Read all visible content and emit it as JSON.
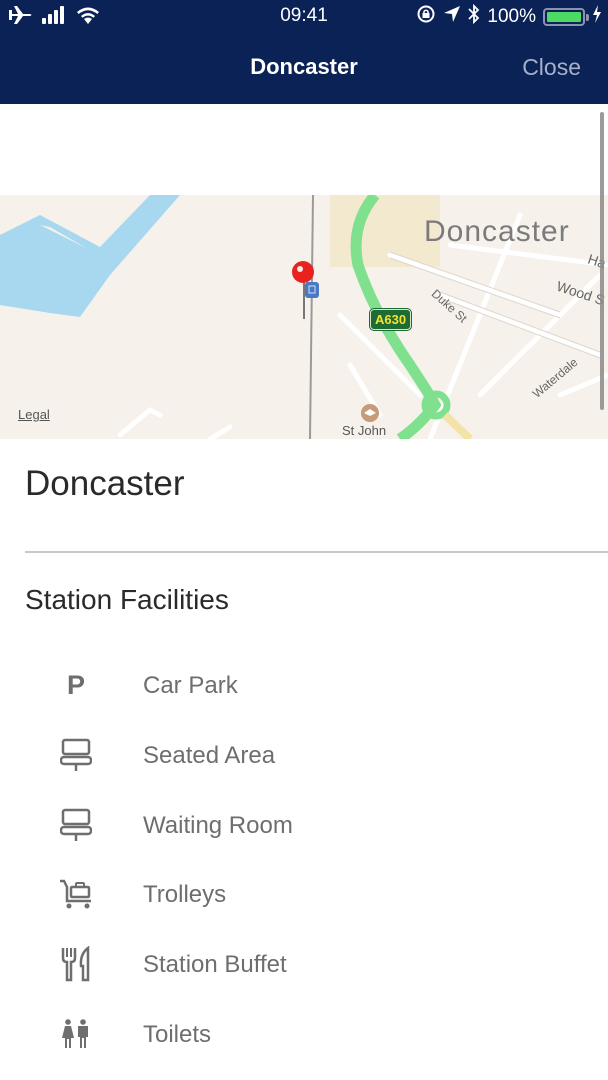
{
  "status_bar": {
    "time": "09:41",
    "battery_percent": "100%",
    "battery_level": 1.0,
    "icons_left": [
      "airplane-icon",
      "signal-icon",
      "wifi-icon"
    ],
    "icons_right": [
      "orientation-lock-icon",
      "location-icon",
      "bluetooth-icon",
      "battery-icon",
      "charging-icon"
    ]
  },
  "nav": {
    "title": "Doncaster",
    "close_label": "Close"
  },
  "map": {
    "city_label": "Doncaster",
    "legal_label": "Legal",
    "road_badge": "A630",
    "streets": [
      "Duke St",
      "Wood S",
      "Ha",
      "Waterdale"
    ],
    "poi_label": "St John",
    "colors": {
      "land": "#f6f1eb",
      "water": "#a7d8ef",
      "major_road": "#7fe08e",
      "pin": "#e8221f",
      "station_marker": "#4a78c2"
    }
  },
  "station": {
    "name": "Doncaster"
  },
  "facilities": {
    "title": "Station Facilities",
    "items": [
      {
        "label": "Car Park",
        "icon": "parking-icon"
      },
      {
        "label": "Seated Area",
        "icon": "seat-icon"
      },
      {
        "label": "Waiting Room",
        "icon": "seat-icon"
      },
      {
        "label": "Trolleys",
        "icon": "trolley-icon"
      },
      {
        "label": "Station Buffet",
        "icon": "cutlery-icon"
      },
      {
        "label": "Toilets",
        "icon": "toilets-icon"
      }
    ]
  }
}
